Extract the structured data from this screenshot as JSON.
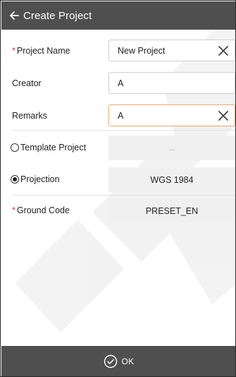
{
  "header": {
    "title": "Create Project"
  },
  "form": {
    "project_name": {
      "label": "Project Name",
      "required_mark": "*",
      "value": "New Project"
    },
    "creator": {
      "label": "Creator",
      "value": "A"
    },
    "remarks": {
      "label": "Remarks",
      "value": "A"
    },
    "template_project": {
      "label": "Template Project",
      "selected": false,
      "value": "..."
    },
    "projection": {
      "label": "Projection",
      "selected": true,
      "value": "WGS 1984"
    },
    "ground_code": {
      "label": "Ground Code",
      "required_mark": "*",
      "value": "PRESET_EN"
    }
  },
  "footer": {
    "ok_label": "OK"
  },
  "colors": {
    "bar": "#4f4f4f",
    "required": "#e5392f",
    "focus_border": "#f0a96b",
    "value_box": "#f0f0f0"
  }
}
